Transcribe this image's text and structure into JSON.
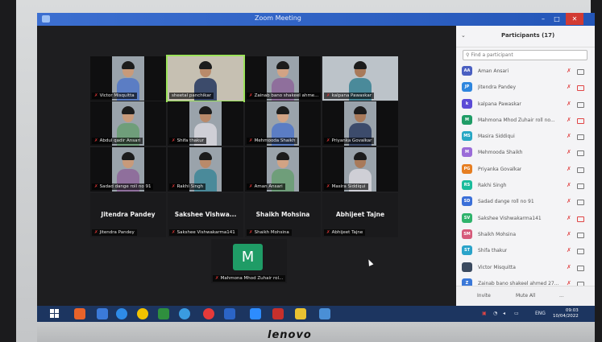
{
  "window": {
    "title": "Zoom Meeting",
    "minimize": "–",
    "maximize": "□",
    "close": "✕"
  },
  "gallery": {
    "video_tiles": [
      {
        "name": "Victor Misquitta",
        "muted": true
      },
      {
        "name": "sheetal panchikar",
        "muted": false,
        "active_speaker": true
      },
      {
        "name": "Zainab bano shakeel ahme...",
        "muted": true
      },
      {
        "name": "kalpana Pawaskar",
        "muted": true
      },
      {
        "name": "Abdul qadir Ansari",
        "muted": true
      },
      {
        "name": "Shifa thakur",
        "muted": true
      },
      {
        "name": "Mehmooda Shaikh",
        "muted": true
      },
      {
        "name": "Priyanka Govalkar",
        "muted": true
      },
      {
        "name": "Sadad dange roll no 91",
        "muted": true
      },
      {
        "name": "Rakhi Singh",
        "muted": true
      },
      {
        "name": "Aman Ansari",
        "muted": true
      },
      {
        "name": "Masira Siddiqui",
        "muted": true
      }
    ],
    "name_tiles": [
      {
        "display": "Jitendra Pandey",
        "tag": "Jitendra Pandey"
      },
      {
        "display": "Sakshee Vishwa...",
        "tag": "Sakshee Vishwakarma141"
      },
      {
        "display": "Shaikh Mohsina",
        "tag": "Shaikh Mohsina"
      },
      {
        "display": "Abhijeet Tajne",
        "tag": "Abhijeet Tajne"
      }
    ],
    "avatar_tile": {
      "letter": "M",
      "tag": "Mahmona Mhod Zuhair rol...",
      "color": "#1f9c66"
    }
  },
  "participants": {
    "title": "Participants (17)",
    "collapse_icon": "chevron-down-icon",
    "search_placeholder": "Find a participant",
    "list": [
      {
        "initials": "AA",
        "name": "Aman Ansari",
        "color": "#4a5fc1"
      },
      {
        "initials": "JP",
        "name": "Jitendra Pandey",
        "color": "#2e86de"
      },
      {
        "initials": "k",
        "name": "kalpana Pawaskar",
        "color": "#5b4bd6"
      },
      {
        "initials": "M",
        "name": "Mahmona Mhod Zuhair roll no...",
        "color": "#1f9c66"
      },
      {
        "initials": "MS",
        "name": "Masira Siddiqui",
        "color": "#27a7c4"
      },
      {
        "initials": "M",
        "name": "Mehmooda Shaikh",
        "color": "#9a6bd8"
      },
      {
        "initials": "PG",
        "name": "Priyanka Govalkar",
        "color": "#e67e22"
      },
      {
        "initials": "RS",
        "name": "Rakhi Singh",
        "color": "#1abc9c"
      },
      {
        "initials": "SD",
        "name": "Sadad dange roll no 91",
        "color": "#3a6fd8"
      },
      {
        "initials": "SV",
        "name": "Sakshee Vishwakarma141",
        "color": "#2fb36b"
      },
      {
        "initials": "SM",
        "name": "Shaikh Mohsina",
        "color": "#d65a7a"
      },
      {
        "initials": "ST",
        "name": "Shifa thakur",
        "color": "#2aa3c9"
      },
      {
        "initials": "",
        "name": "Victor Misquitta",
        "color": "#3b4a5f"
      },
      {
        "initials": "Z",
        "name": "Zainab bano shakeel ahmed 27...",
        "color": "#3a78d8"
      }
    ],
    "footer": {
      "invite": "Invite",
      "mute_all": "Mute All",
      "more": "..."
    }
  },
  "taskbar": {
    "clock_time": "09:03",
    "clock_date": "10/04/2022",
    "tray_lang": "ENG"
  },
  "monitor": {
    "brand": "lenovo"
  }
}
